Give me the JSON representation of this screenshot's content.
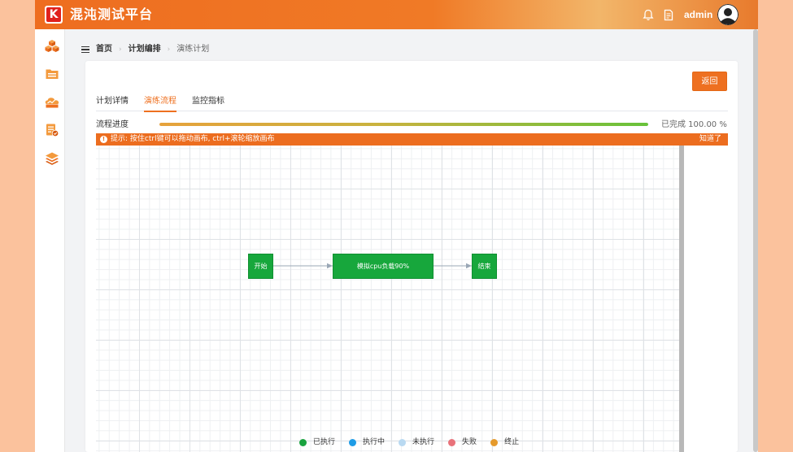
{
  "header": {
    "logo_letter": "K",
    "title": "混沌测试平台",
    "username": "admin"
  },
  "sidebar": {
    "items": [
      {
        "icon": "cubes-icon"
      },
      {
        "icon": "folder-icon"
      },
      {
        "icon": "cloud-monitor-icon"
      },
      {
        "icon": "report-icon"
      },
      {
        "icon": "layers-icon"
      }
    ]
  },
  "breadcrumb": {
    "home": "首页",
    "level2": "计划编排",
    "current": "演练计划"
  },
  "actions": {
    "back_label": "返回"
  },
  "tabs": [
    {
      "label": "计划详情",
      "active": false
    },
    {
      "label": "演练流程",
      "active": true
    },
    {
      "label": "监控指标",
      "active": false
    }
  ],
  "progress": {
    "label": "流程进度",
    "value_percent": 100,
    "text": "已完成 100.00 %"
  },
  "tip": {
    "icon": "!",
    "text": "提示: 按住ctrl键可以拖动画布, ctrl+滚轮缩放画布",
    "dismiss_label": "知道了"
  },
  "flow": {
    "nodes": [
      {
        "id": "start",
        "label": "开始",
        "status": "done"
      },
      {
        "id": "task",
        "label": "模拟cpu负载90%",
        "status": "done"
      },
      {
        "id": "end",
        "label": "结束",
        "status": "done"
      }
    ]
  },
  "legend": [
    {
      "label": "已执行",
      "color": "#1aa33f"
    },
    {
      "label": "执行中",
      "color": "#1e9ce6"
    },
    {
      "label": "未执行",
      "color": "#b9d9f1"
    },
    {
      "label": "失败",
      "color": "#e8727a"
    },
    {
      "label": "终止",
      "color": "#e59a2c"
    }
  ],
  "colors": {
    "accent": "#ee7020",
    "success": "#17a73c"
  }
}
